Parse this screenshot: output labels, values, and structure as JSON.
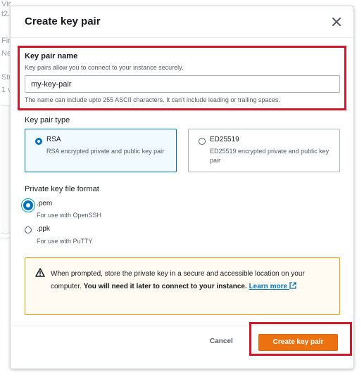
{
  "background": {
    "lines": [
      "Virtual",
      "t2.",
      "Fir",
      "Ne",
      "Sto",
      "1 v"
    ]
  },
  "modal": {
    "title": "Create key pair",
    "close_icon": "close-icon"
  },
  "key_pair_name": {
    "label": "Key pair name",
    "description": "Key pairs allow you to connect to your instance securely.",
    "value": "my-key-pair",
    "constraint": "The name can include upto 255 ASCII characters. It can't include leading or trailing spaces."
  },
  "key_pair_type": {
    "label": "Key pair type",
    "options": [
      {
        "title": "RSA",
        "description": "RSA encrypted private and public key pair",
        "selected": true
      },
      {
        "title": "ED25519",
        "description": "ED25519 encrypted private and public key pair",
        "selected": false
      }
    ]
  },
  "private_key_format": {
    "label": "Private key file format",
    "options": [
      {
        "title": ".pem",
        "description": "For use with OpenSSH",
        "selected": true
      },
      {
        "title": ".ppk",
        "description": "For use with PuTTY",
        "selected": false
      }
    ]
  },
  "alert": {
    "icon": "warning-icon",
    "text_before": "When prompted, store the private key in a secure and accessible location on your computer. ",
    "text_bold": "You will need it later to connect to your instance.",
    "link_text": "Learn more",
    "link_icon": "external-link-icon"
  },
  "footer": {
    "cancel_label": "Cancel",
    "create_label": "Create key pair"
  },
  "colors": {
    "accent": "#0073bb",
    "primary_button": "#ec7211",
    "highlight": "#d0182a",
    "warning": "#ff9900"
  }
}
